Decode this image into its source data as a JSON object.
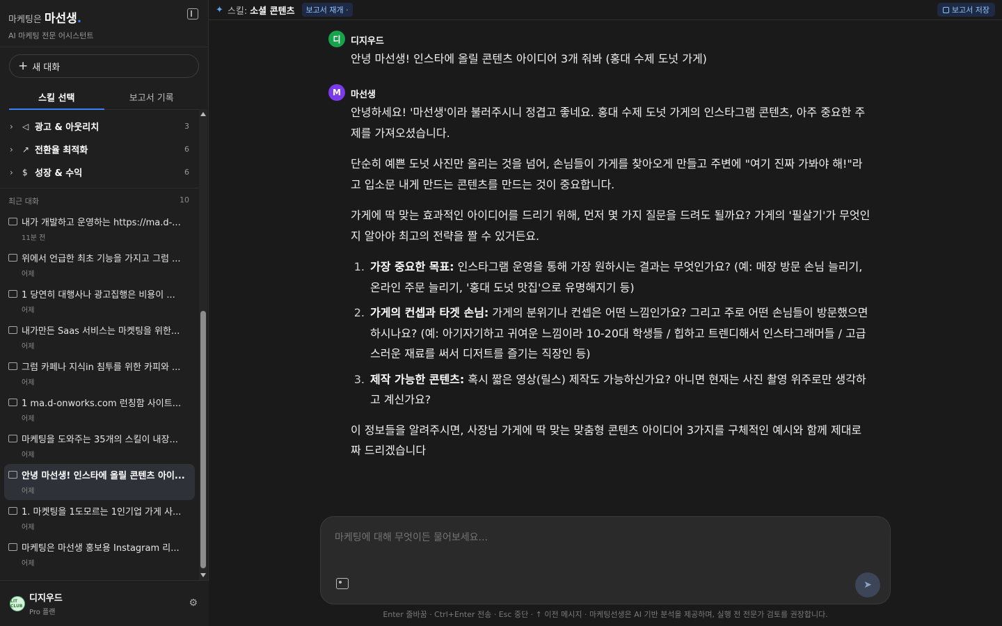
{
  "brand": {
    "prefix": "마케팅은",
    "name": "마선생",
    "dot": ".",
    "subtitle": "AI 마케팅 전문 어시스턴트"
  },
  "sidebar": {
    "new_chat": "새 대화",
    "tabs": [
      {
        "label": "스킬 선택",
        "active": true
      },
      {
        "label": "보고서 기록",
        "active": false
      }
    ],
    "categories": [
      {
        "icon": "megaphone-icon",
        "label": "광고 & 아웃리치",
        "count": "3"
      },
      {
        "icon": "trend-icon",
        "label": "전환율 최적화",
        "count": "6"
      },
      {
        "icon": "dollar-icon",
        "label": "성장 & 수익",
        "count": "6"
      }
    ],
    "recent_label": "최근 대화",
    "recent_count": "10",
    "conversations": [
      {
        "title": "내가 개발하고 운영하는 https://ma.d-...",
        "time": "11분 전",
        "active": false
      },
      {
        "title": "위에서 언급한 최초 기능을 가지고 그럼 ...",
        "time": "어제",
        "active": false
      },
      {
        "title": "1 당연히 대행사나 광고집행은 비용이 ...",
        "time": "어제",
        "active": false
      },
      {
        "title": "내가만든 Saas 서비스는 마켓팅을 위한...",
        "time": "어제",
        "active": false
      },
      {
        "title": "그럼 카페나 지식in 침투를 위한 카피와 ...",
        "time": "어제",
        "active": false
      },
      {
        "title": "1 ma.d-onworks.com 런칭함 사이트...",
        "time": "어제",
        "active": false
      },
      {
        "title": "마케팅을 도와주는 35개의 스킬이 내장...",
        "time": "어제",
        "active": false
      },
      {
        "title": "안녕 마선생! 인스타에 올릴 콘텐츠 아이...",
        "time": "어제",
        "active": true
      },
      {
        "title": "1. 마켓팅을 1도모르는 1인기업 가게 사...",
        "time": "어제",
        "active": false
      },
      {
        "title": "마케팅은 마선생 홍보용 Instagram 리...",
        "time": "어제",
        "active": false
      }
    ]
  },
  "user": {
    "avatar_text": "LIT CLUB",
    "name": "디지우드",
    "plan": "Pro 플랜"
  },
  "topbar": {
    "skill_label": "스킬:",
    "skill_name": "소셜 콘텐츠",
    "badge": "보고서 재개 ·",
    "save": "보고서 저장"
  },
  "chat": {
    "user_msg": {
      "avatar": "디",
      "sender": "디지우드",
      "text": "안녕 마선생! 인스타에 올릴 콘텐츠 아이디어 3개 줘봐 (홍대 수제 도넛 가게)"
    },
    "ai_msg": {
      "avatar": "M",
      "sender": "마선생",
      "p1": "안녕하세요! '마선생'이라 불러주시니 정겹고 좋네요. 홍대 수제 도넛 가게의 인스타그램 콘텐츠, 아주 중요한 주제를 가져오셨습니다.",
      "p2": "단순히 예쁜 도넛 사진만 올리는 것을 넘어, 손님들이 가게를 찾아오게 만들고 주변에 \"여기 진짜 가봐야 해!\"라고 입소문 내게 만드는 콘텐츠를 만드는 것이 중요합니다.",
      "p3": "가게에 딱 맞는 효과적인 아이디어를 드리기 위해, 먼저 몇 가지 질문을 드려도 될까요? 가게의 '필살기'가 무엇인지 알아야 최고의 전략을 짤 수 있거든요.",
      "questions": [
        {
          "num": "1.",
          "bold": "가장 중요한 목표:",
          "text": " 인스타그램 운영을 통해 가장 원하시는 결과는 무엇인가요? (예: 매장 방문 손님 늘리기, 온라인 주문 늘리기, '홍대 도넛 맛집'으로 유명해지기 등)"
        },
        {
          "num": "2.",
          "bold": "가게의 컨셉과 타겟 손님:",
          "text": " 가게의 분위기나 컨셉은 어떤 느낌인가요? 그리고 주로 어떤 손님들이 방문했으면 하시나요? (예: 아기자기하고 귀여운 느낌이라 10-20대 학생들 / 힙하고 트렌디해서 인스타그래머들 / 고급스러운 재료를 써서 디저트를 즐기는 직장인 등)"
        },
        {
          "num": "3.",
          "bold": "제작 가능한 콘텐츠:",
          "text": " 혹시 짧은 영상(릴스) 제작도 가능하신가요? 아니면 현재는 사진 촬영 위주로만 생각하고 계신가요?"
        }
      ],
      "p4": "이 정보들을 알려주시면, 사장님 가게에 딱 맞는 맞춤형 콘텐츠 아이디어 3가지를 구체적인 예시와 함께 제대로 짜 드리겠습니다"
    }
  },
  "composer": {
    "placeholder": "마케팅에 대해 무엇이든 물어보세요..."
  },
  "footer": {
    "hint": "Enter 줄바꿈 · Ctrl+Enter 전송 · Esc 중단 · ↑ 이전 메시지 · 마케팅선생은 AI 기반 분석을 제공하며, 실행 전 전문가 검토를 권장합니다."
  },
  "colors": {
    "accent": "#3b82f6",
    "user_avatar": "#16a34a",
    "ai_avatar": "#7c3aed",
    "active_conv": "#2e3138"
  }
}
